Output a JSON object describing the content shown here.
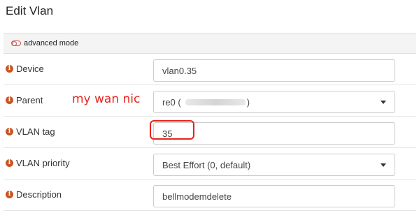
{
  "page": {
    "title": "Edit Vlan",
    "advanced_mode_label": "advanced mode"
  },
  "fields": {
    "device": {
      "label": "Device",
      "value": "vlan0.35"
    },
    "parent": {
      "label": "Parent",
      "value": "re0 (",
      "value_suffix": ")"
    },
    "vlan_tag": {
      "label": "VLAN tag",
      "value": "35"
    },
    "vlan_priority": {
      "label": "VLAN priority",
      "value": "Best Effort (0, default)"
    },
    "description": {
      "label": "Description",
      "value": "bellmodemdelete"
    }
  },
  "annotations": {
    "parent_note": "my wan nic",
    "highlight_color": "#e8241c"
  },
  "colors": {
    "info_icon": "#cc5420",
    "toggle": "#d9534f"
  },
  "icons": {
    "info": "info-circle-icon",
    "advanced_toggle": "toggle-off-icon",
    "select_caret": "caret-down-icon"
  }
}
